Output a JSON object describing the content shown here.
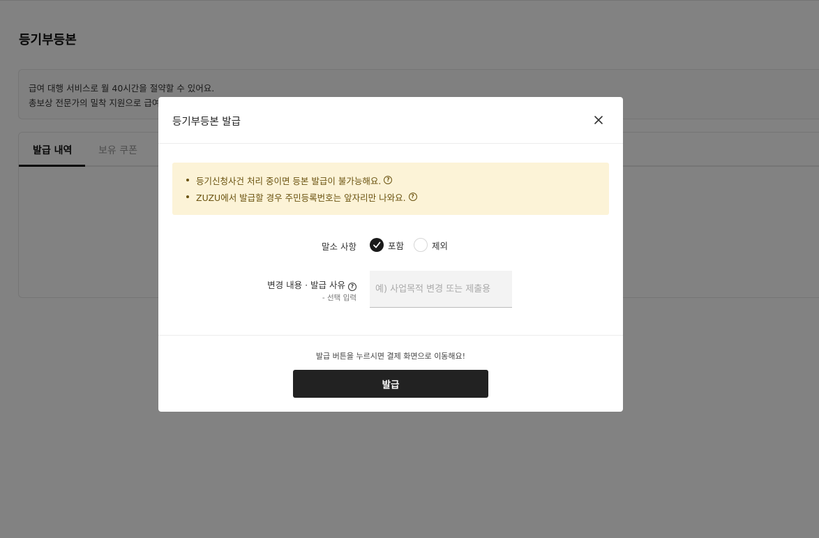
{
  "page": {
    "title": "등기부등본",
    "promo_line1": "급여 대행 서비스로 월 40시간을 절약할 수 있어요.",
    "promo_line2": "총보상 전문가의 밀착 지원으로 급여"
  },
  "tabs": [
    {
      "label": "발급 내역",
      "active": true
    },
    {
      "label": "보유 쿠폰",
      "active": false
    }
  ],
  "modal": {
    "title": "등기부등본 발급",
    "close_icon": "close-icon",
    "notices": [
      "등기신청사건 처리 중이면 등본 발급이 불가능해요.",
      "ZUZU에서 발급할 경우 주민등록번호는 앞자리만 나와요."
    ],
    "help_glyph": "?",
    "malso": {
      "label": "말소 사항",
      "options": [
        {
          "label": "포함",
          "checked": true
        },
        {
          "label": "제외",
          "checked": false
        }
      ]
    },
    "reason": {
      "label": "변경 내용 · 발급 사유",
      "sub_label": "- 선택 입력",
      "placeholder": "예) 사업목적 변경 또는 제출용",
      "value": ""
    },
    "footer_note": "발급 버튼을 누르시면 결제 화면으로 이동해요!",
    "submit_label": "발급"
  },
  "colors": {
    "overlay": "#00000080",
    "notice_bg": "#fcf3d7",
    "notice_text": "#6b5310",
    "primary_button": "#222222"
  }
}
